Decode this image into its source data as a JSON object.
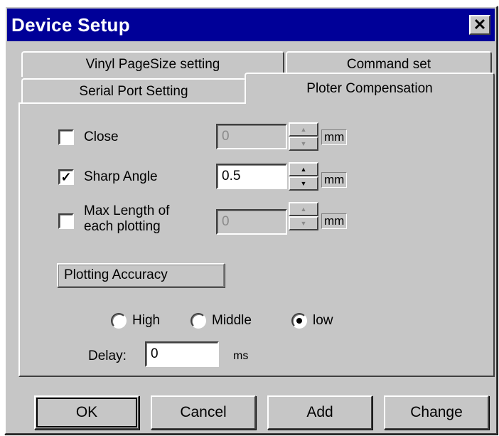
{
  "window": {
    "title": "Device Setup",
    "close_glyph": "✕"
  },
  "tabs": {
    "vinyl_pagesize": "Vinyl PageSize setting",
    "command_set": "Command set",
    "serial_port": "Serial Port Setting",
    "plotter_compensation": "Ploter Compensation"
  },
  "compensation": {
    "close": {
      "label": "Close",
      "checked": false,
      "value": "0",
      "unit": "mm",
      "enabled": false
    },
    "sharp_angle": {
      "label": "Sharp Angle",
      "checked": true,
      "check_glyph": "✓",
      "value": "0.5",
      "unit": "mm",
      "enabled": true
    },
    "max_length": {
      "label_line1": "Max Length of",
      "label_line2": "each plotting",
      "checked": false,
      "value": "0",
      "unit": "mm",
      "enabled": false
    }
  },
  "accuracy": {
    "label": "Plotting Accuracy",
    "options": [
      "High",
      "Middle",
      "low"
    ],
    "selected": "low"
  },
  "delay": {
    "label": "Delay:",
    "value": "0",
    "unit": "ms"
  },
  "buttons": {
    "ok": "OK",
    "cancel": "Cancel",
    "add": "Add",
    "change": "Change"
  },
  "icons": {
    "spin_up": "▲",
    "spin_down": "▼"
  }
}
